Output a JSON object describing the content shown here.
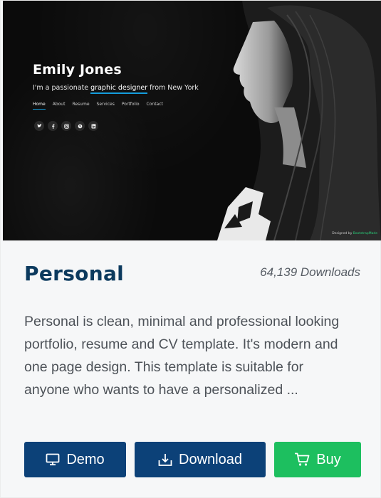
{
  "preview": {
    "hero_name": "Emily Jones",
    "tagline_before": "I'm a passionate ",
    "tagline_highlight": "graphic designer",
    "tagline_after": " from New York",
    "nav": [
      "Home",
      "About",
      "Resume",
      "Services",
      "Portfolio",
      "Contact"
    ],
    "social_icons": [
      "twitter-icon",
      "facebook-icon",
      "instagram-icon",
      "skype-icon",
      "linkedin-icon"
    ],
    "credit_prefix": "Designed by ",
    "credit_brand": "BootstrapMade",
    "accent_color": "#149ddd"
  },
  "card": {
    "title": "Personal",
    "downloads": "64,139 Downloads",
    "description": "Personal is clean, minimal and professional looking portfolio, resume and CV template. It's modern and one page design. This template is suitable for anyone who wants to have a personalized ..."
  },
  "buttons": {
    "demo_label": "Demo",
    "download_label": "Download",
    "buy_label": "Buy"
  },
  "colors": {
    "title": "#0c3a5e",
    "primary_button": "#0c4178",
    "buy_button": "#1dbf5f"
  }
}
